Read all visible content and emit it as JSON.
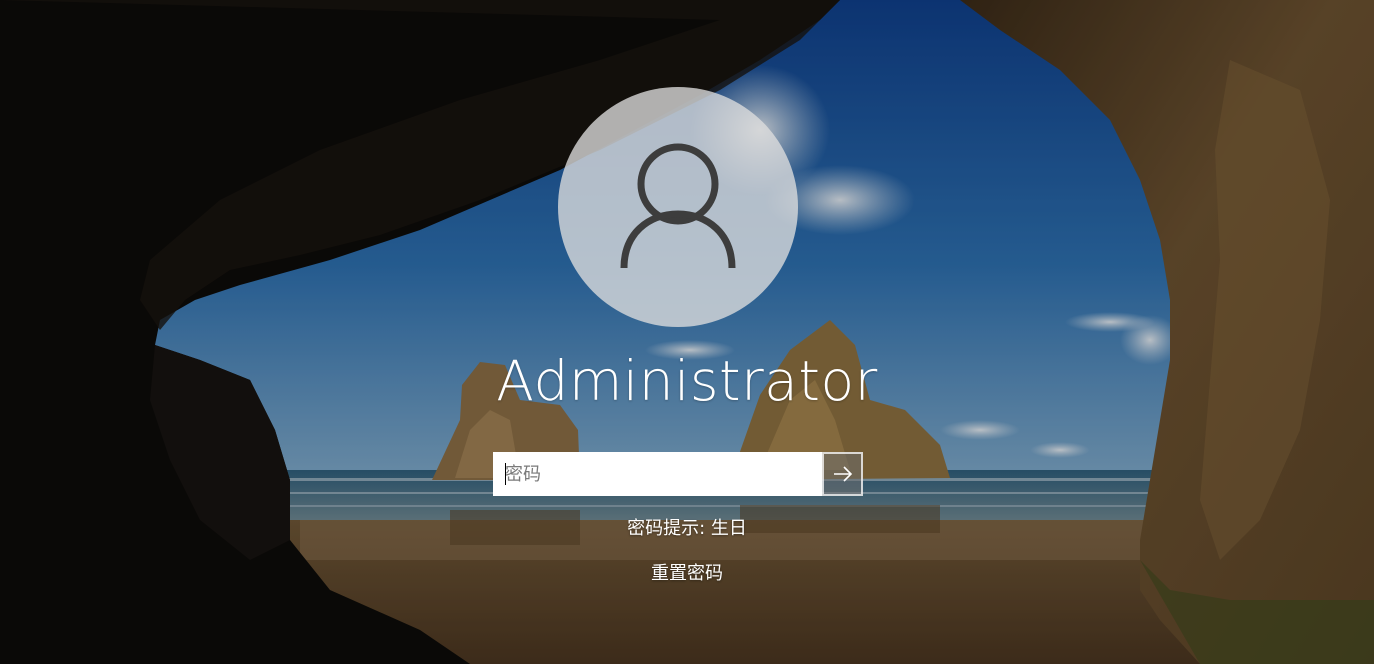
{
  "user": {
    "name": "Administrator",
    "avatar_icon": "user-avatar-icon"
  },
  "password": {
    "placeholder": "密码",
    "value": "",
    "submit_icon": "arrow-right-icon"
  },
  "hint": {
    "text": "密码提示: 生日"
  },
  "reset": {
    "label": "重置密码"
  },
  "colors": {
    "text": "#ffffff",
    "input_bg": "#ffffff",
    "avatar_bg": "#dedede",
    "sky": "#2f6fb0",
    "sand": "#6b4f30"
  }
}
